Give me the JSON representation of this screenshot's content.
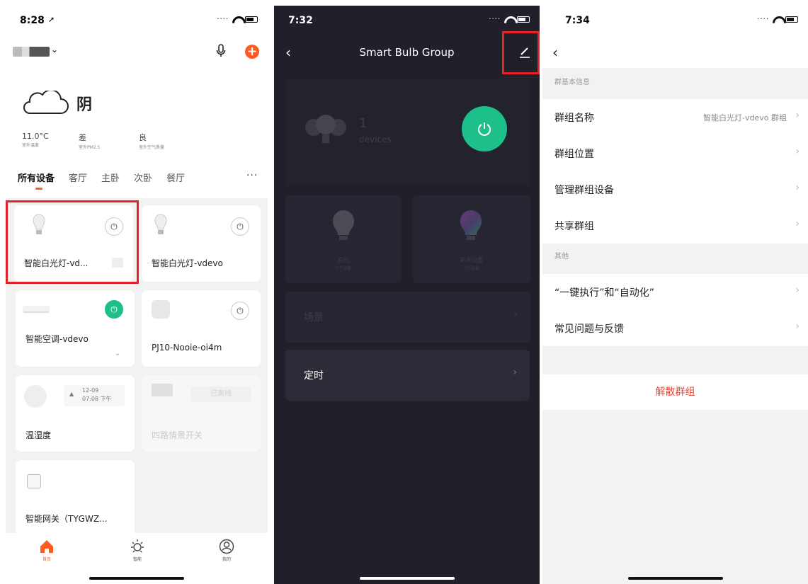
{
  "panel1": {
    "status_time": "8:28",
    "weather": {
      "condition": "阴",
      "stats": [
        {
          "value": "11.0°C",
          "label": "室外温度"
        },
        {
          "value": "差",
          "label": "室外PM2.5"
        },
        {
          "value": "良",
          "label": "室外空气质量"
        }
      ]
    },
    "tabs": [
      "所有设备",
      "客厅",
      "主卧",
      "次卧",
      "餐厅"
    ],
    "tab_more": "···",
    "devices": [
      {
        "name": "智能白光灯-vd..."
      },
      {
        "name": "智能白光灯-vdevo"
      },
      {
        "name": "智能空调-vdevo"
      },
      {
        "name": "PJ10-Nooie-oi4m"
      },
      {
        "name": "温湿度",
        "date": "12-09",
        "time": "07:08 下午"
      },
      {
        "name": "四路情景开关",
        "offline": "已离线"
      },
      {
        "name": "智能网关（TYGWZ..."
      }
    ],
    "tabbar": [
      {
        "label": "首页"
      },
      {
        "label": "智能"
      },
      {
        "label": "我的"
      }
    ],
    "accent": "#ff5a1f"
  },
  "panel2": {
    "status_time": "7:32",
    "title": "Smart Bulb Group",
    "device_count": "1",
    "device_unit": "devices",
    "modes": [
      {
        "label": "白光",
        "sub": "0个设备"
      },
      {
        "label": "彩光设置",
        "sub": "0个设备"
      }
    ],
    "scene_label": "场景",
    "timer_label": "定时",
    "power_color": "#1dbf8b"
  },
  "panel3": {
    "status_time": "7:34",
    "section1": "群基本信息",
    "rows1": [
      {
        "label": "群组名称",
        "value": "智能白光灯-vdevo 群组"
      },
      {
        "label": "群组位置",
        "value": ""
      },
      {
        "label": "管理群组设备",
        "value": ""
      },
      {
        "label": "共享群组",
        "value": ""
      }
    ],
    "section2": "其他",
    "rows2": [
      {
        "label": "“一键执行”和“自动化”"
      },
      {
        "label": "常见问题与反馈"
      }
    ],
    "dissolve": "解散群组"
  }
}
